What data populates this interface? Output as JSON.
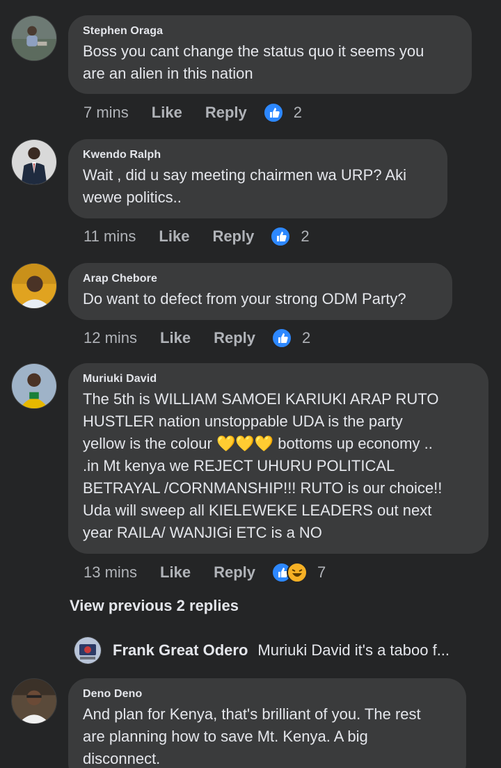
{
  "comments": [
    {
      "author": "Stephen Oraga",
      "text": "Boss you cant change the status quo it seems you\nare an alien in this nation",
      "time": "7 mins",
      "like_label": "Like",
      "reply_label": "Reply",
      "reaction_count": "2",
      "reactions": [
        "like-icon"
      ]
    },
    {
      "author": "Kwendo Ralph",
      "text": "Wait , did u say meeting chairmen wa URP? Aki\nwewe politics..",
      "time": "11 mins",
      "like_label": "Like",
      "reply_label": "Reply",
      "reaction_count": "2",
      "reactions": [
        "like-icon"
      ]
    },
    {
      "author": "Arap Chebore",
      "text": "Do want to defect from your strong ODM Party?",
      "time": "12 mins",
      "like_label": "Like",
      "reply_label": "Reply",
      "reaction_count": "2",
      "reactions": [
        "like-icon"
      ]
    },
    {
      "author": "Muriuki David",
      "text": "The 5th is WILLIAM SAMOEI KARIUKI ARAP RUTO\nHUSTLER nation unstoppable UDA is the party\nyellow is the colour 💛💛💛 bottoms up economy ..\n.in Mt kenya we REJECT UHURU POLITICAL\nBETRAYAL  /CORNMANSHIP!!! RUTO is our choice!!\nUda will sweep all KIELEWEKE LEADERS out next\nyear RAILA/ WANJIGi ETC is a NO",
      "time": "13 mins",
      "like_label": "Like",
      "reply_label": "Reply",
      "reaction_count": "7",
      "reactions": [
        "like-icon",
        "haha-icon"
      ]
    },
    {
      "author": "Deno Deno",
      "text": "And plan for Kenya, that's brilliant of you. The rest\nare planning how to save Mt. Kenya. A big\ndisconnect."
    }
  ],
  "view_previous": "View previous 2 replies",
  "reply_preview": {
    "name": "Frank Great Odero",
    "snippet": "Muriuki David it's a taboo f..."
  },
  "colors": {
    "background": "#242526",
    "bubble": "#3a3b3c",
    "like_blue": "#2d88ff",
    "haha_yellow": "#f7b125",
    "secondary_text": "#b0b3b8"
  }
}
